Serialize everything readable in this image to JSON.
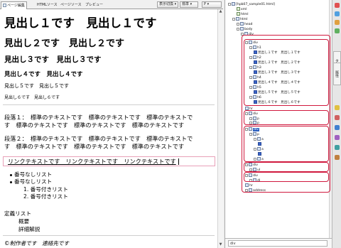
{
  "tabs": [
    {
      "label": "ページ編集",
      "active": true
    },
    {
      "label": "HTMLソース",
      "active": false
    },
    {
      "label": "ページソース",
      "active": false
    },
    {
      "label": "プレビュー",
      "active": false
    }
  ],
  "toolbar": {
    "display_switch": "表示切換",
    "mode_select": "標準",
    "style_select": "P"
  },
  "document": {
    "h1": "見出し１です　見出し１です",
    "h2": "見出し２です　見出し２です",
    "h3": "見出し３です　見出し３です",
    "h4": "見出し４です　見出し４です",
    "h5": "見出し５です　見出し５です",
    "h6": "見出し６です　見出し６です",
    "paragraph1": [
      "段落１：　標準のテキストです　標準のテキストです　標準のテキストで",
      "す　標準のテキストです　標準のテキストです　標準のテキストです"
    ],
    "paragraph2": [
      "段落２：　標準のテキストです　標準のテキストです　標準のテキストで",
      "す　標準のテキストです　標準のテキストです　標準のテキストです"
    ],
    "link": "リンクテキストです　リンクテキストです　リンクテキストです",
    "unordered": [
      "番号なしリスト",
      "番号なしリスト"
    ],
    "ordered": [
      "1.  番号付きリスト",
      "2.  番号付きリスト"
    ],
    "definition_term": "定義リスト",
    "definition_items": [
      "概要",
      "詳細解説"
    ],
    "address": "©制作者です　連絡先です"
  },
  "tree": {
    "root": "[hpb07_sample01.html]",
    "xml": "xml",
    "html1": "html",
    "html2": "html",
    "head": "head",
    "body": "body",
    "div": "div",
    "h1": "h1",
    "h2": "h2",
    "h3": "h3",
    "h4": "h4",
    "h5": "h5",
    "h6": "h6",
    "h1_text": "見出し１です　見出し１です",
    "h2_text": "見出し２です　見出し２です",
    "h3_text": "見出し３です　見出し３です",
    "h4_text": "見出し４です　見出し４です",
    "h5_text": "見出し５です　見出し５です",
    "h6_text": "見出し６です　見出し６です",
    "hr": "hr",
    "p": "p",
    "a": "a",
    "ul": "ul",
    "dl": "dl",
    "address": "address"
  },
  "status": {
    "path": "div"
  },
  "dock_tabs": [
    "タグ",
    "属性"
  ],
  "colors": {
    "highlight": "#d0193e",
    "link": "#1010e0"
  }
}
